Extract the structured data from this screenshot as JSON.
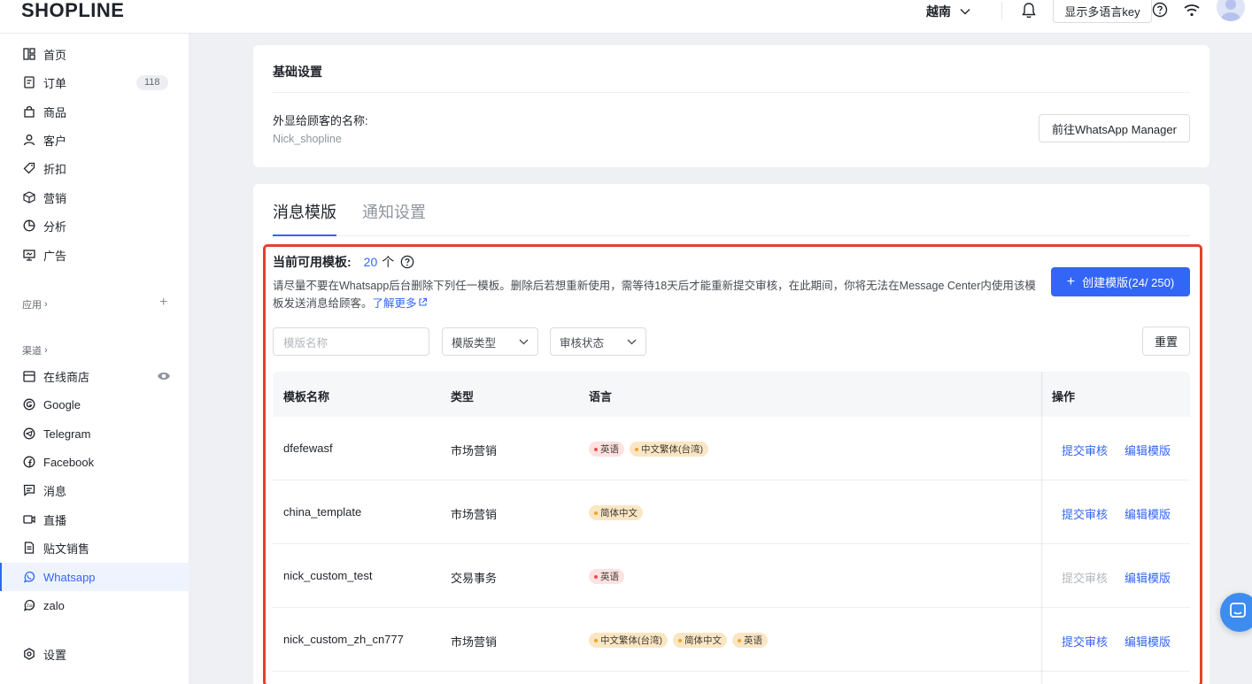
{
  "header": {
    "logo": "SHOPLINE",
    "region": "越南",
    "lang_key_button": "显示多语言key"
  },
  "sidebar": {
    "items": [
      {
        "label": "首页",
        "icon": "dashboard-icon"
      },
      {
        "label": "订单",
        "icon": "order-icon",
        "badge": "118"
      },
      {
        "label": "商品",
        "icon": "bag-icon"
      },
      {
        "label": "客户",
        "icon": "user-icon"
      },
      {
        "label": "折扣",
        "icon": "tag-icon"
      },
      {
        "label": "营销",
        "icon": "box-icon"
      },
      {
        "label": "分析",
        "icon": "pie-icon"
      },
      {
        "label": "广告",
        "icon": "ad-icon"
      }
    ],
    "apps_label": "应用",
    "channels_label": "渠道",
    "channels": [
      {
        "label": "在线商店",
        "icon": "store-icon"
      },
      {
        "label": "Google",
        "icon": "google-icon"
      },
      {
        "label": "Telegram",
        "icon": "telegram-icon"
      },
      {
        "label": "Facebook",
        "icon": "facebook-icon"
      },
      {
        "label": "消息",
        "icon": "message-icon"
      },
      {
        "label": "直播",
        "icon": "live-icon"
      },
      {
        "label": "贴文销售",
        "icon": "post-icon"
      },
      {
        "label": "Whatsapp",
        "icon": "whatsapp-icon",
        "active": true
      },
      {
        "label": "zalo",
        "icon": "zalo-icon"
      }
    ],
    "settings_label": "设置"
  },
  "basic": {
    "title": "基础设置",
    "display_name_label": "外显给顾客的名称:",
    "display_name_value": "Nick_shopline",
    "manager_button": "前往WhatsApp Manager"
  },
  "tabs": [
    "消息模版",
    "通知设置"
  ],
  "templates": {
    "available_label": "当前可用模板:",
    "available_count": "20",
    "available_unit": "个",
    "note": "请尽量不要在Whatsapp后台删除下列任一模板。删除后若想重新使用，需等待18天后才能重新提交审核，在此期间，你将无法在Message Center内使用该模板发送消息给顾客。",
    "learn_more": "了解更多",
    "create_button": "创建模版(24/ 250)",
    "filters": {
      "name_placeholder": "模版名称",
      "type_select": "模版类型",
      "status_select": "审核状态",
      "reset_button": "重置"
    },
    "columns": [
      "模板名称",
      "类型",
      "语言",
      "操作"
    ],
    "rows": [
      {
        "name": "dfefewasf",
        "type": "市场营销",
        "langs": [
          {
            "text": "英语",
            "color": "red"
          },
          {
            "text": "中文繁体(台湾)",
            "color": "orange"
          }
        ],
        "submit": "提交审核",
        "submit_enabled": true,
        "edit": "编辑模版"
      },
      {
        "name": "china_template",
        "type": "市场营销",
        "langs": [
          {
            "text": "简体中文",
            "color": "orange"
          }
        ],
        "submit": "提交审核",
        "submit_enabled": true,
        "edit": "编辑模版"
      },
      {
        "name": "nick_custom_test",
        "type": "交易事务",
        "langs": [
          {
            "text": "英语",
            "color": "red"
          }
        ],
        "submit": "提交审核",
        "submit_enabled": false,
        "edit": "编辑模版"
      },
      {
        "name": "nick_custom_zh_cn777",
        "type": "市场营销",
        "langs": [
          {
            "text": "中文繁体(台湾)",
            "color": "orange"
          },
          {
            "text": "简体中文",
            "color": "orange"
          },
          {
            "text": "英语",
            "color": "orange"
          }
        ],
        "submit": "提交审核",
        "submit_enabled": true,
        "edit": "编辑模版"
      }
    ]
  },
  "colors": {
    "accent": "#3366f6",
    "highlight_border": "#e5402d"
  }
}
